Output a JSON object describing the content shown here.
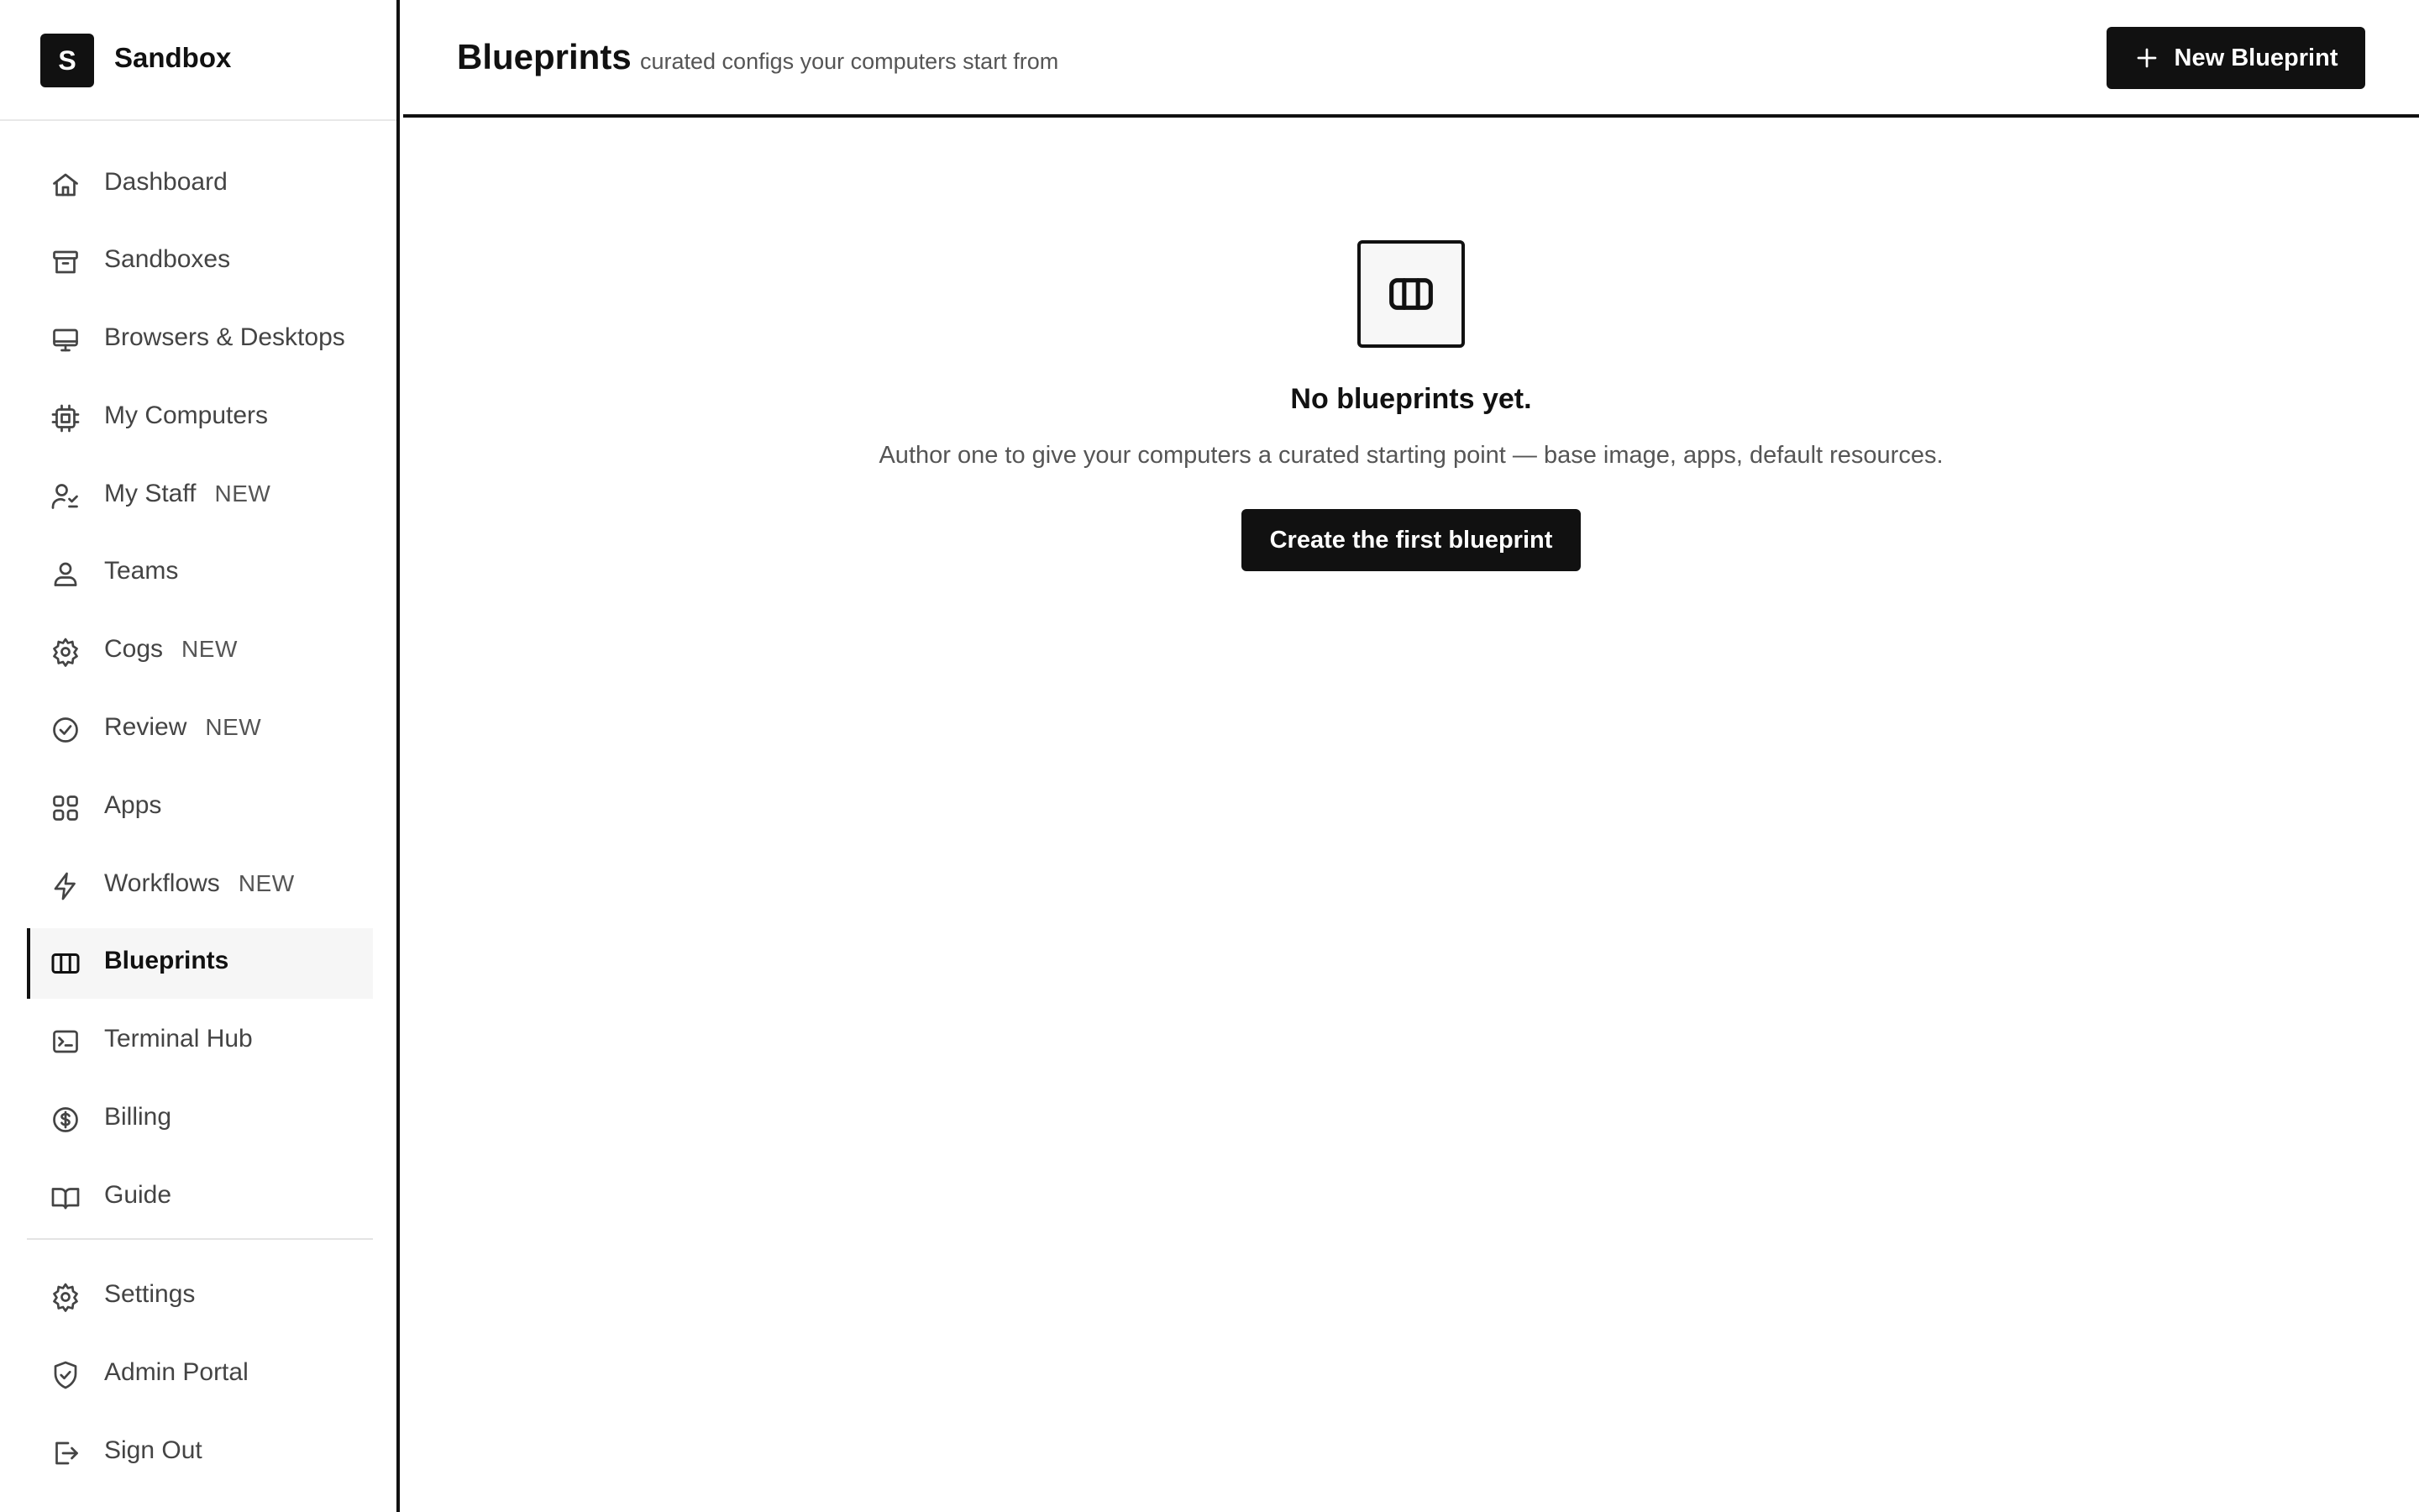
{
  "brand": {
    "logo_letter": "S",
    "name": "Sandbox"
  },
  "nav": {
    "items": [
      {
        "label": "Dashboard",
        "icon": "home-icon",
        "badge": ""
      },
      {
        "label": "Sandboxes",
        "icon": "archive-icon",
        "badge": ""
      },
      {
        "label": "Browsers & Desktops",
        "icon": "monitor-icon",
        "badge": ""
      },
      {
        "label": "My Computers",
        "icon": "cpu-icon",
        "badge": ""
      },
      {
        "label": "My Staff",
        "icon": "staff-icon",
        "badge": "NEW"
      },
      {
        "label": "Teams",
        "icon": "users-icon",
        "badge": ""
      },
      {
        "label": "Cogs",
        "icon": "cog-icon",
        "badge": "NEW"
      },
      {
        "label": "Review",
        "icon": "check-circle-icon",
        "badge": "NEW"
      },
      {
        "label": "Apps",
        "icon": "grid-icon",
        "badge": ""
      },
      {
        "label": "Workflows",
        "icon": "lightning-icon",
        "badge": "NEW"
      },
      {
        "label": "Blueprints",
        "icon": "blueprint-columns-icon",
        "badge": "",
        "active": true
      },
      {
        "label": "Terminal Hub",
        "icon": "terminal-icon",
        "badge": ""
      },
      {
        "label": "Billing",
        "icon": "dollar-circle-icon",
        "badge": ""
      },
      {
        "label": "Guide",
        "icon": "book-icon",
        "badge": ""
      }
    ],
    "bottom_items": [
      {
        "label": "Settings",
        "icon": "gear-icon"
      },
      {
        "label": "Admin Portal",
        "icon": "shield-icon"
      },
      {
        "label": "Sign Out",
        "icon": "sign-out-icon"
      }
    ]
  },
  "header": {
    "title": "Blueprints",
    "subtitle": "curated configs your computers start from",
    "new_button_label": "New Blueprint",
    "new_button_icon": "plus-icon"
  },
  "empty_state": {
    "icon": "blueprint-columns-icon",
    "title": "No blueprints yet.",
    "text": "Author one to give your computers a curated starting point — base image, apps, default resources.",
    "button_label": "Create the first blueprint"
  },
  "colors": {
    "primary": "#111111",
    "text_muted": "#555555",
    "active_bg": "#f6f6f6",
    "divider": "#e4e4e4"
  }
}
